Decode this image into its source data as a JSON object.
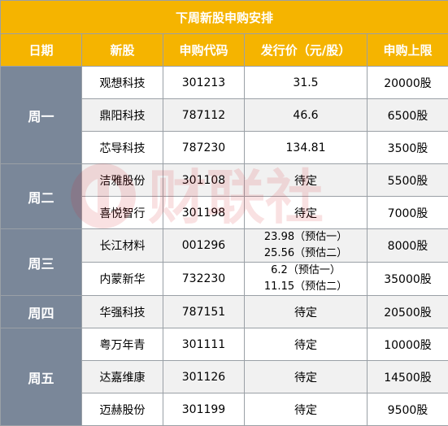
{
  "title": "下周新股申购安排",
  "headers": [
    "日期",
    "新股",
    "申购代码",
    "发行价（元/股）",
    "申购上限"
  ],
  "groups": [
    {
      "day": "周一",
      "rows": [
        {
          "name": "观想科技",
          "code": "301213",
          "price": "31.5",
          "limit": "20000股"
        },
        {
          "name": "鼎阳科技",
          "code": "787112",
          "price": "46.6",
          "limit": "6500股"
        },
        {
          "name": "芯导科技",
          "code": "787230",
          "price": "134.81",
          "limit": "3500股"
        }
      ]
    },
    {
      "day": "周二",
      "rows": [
        {
          "name": "洁雅股份",
          "code": "301108",
          "price": "待定",
          "limit": "5500股"
        },
        {
          "name": "喜悦智行",
          "code": "301198",
          "price": "待定",
          "limit": "7000股"
        }
      ]
    },
    {
      "day": "周三",
      "rows": [
        {
          "name": "长江材料",
          "code": "001296",
          "price_lines": [
            "23.98（预估一）",
            "25.56（预估二）"
          ],
          "limit": "8000股"
        },
        {
          "name": "内蒙新华",
          "code": "732230",
          "price_lines": [
            "6.2（预估一）",
            "11.15（预估二）"
          ],
          "limit": "35000股"
        }
      ]
    },
    {
      "day": "周四",
      "rows": [
        {
          "name": "华强科技",
          "code": "787151",
          "price": "待定",
          "limit": "20500股"
        }
      ]
    },
    {
      "day": "周五",
      "rows": [
        {
          "name": "粤万年青",
          "code": "301111",
          "price": "待定",
          "limit": "10000股"
        },
        {
          "name": "达嘉维康",
          "code": "301126",
          "price": "待定",
          "limit": "14500股"
        },
        {
          "name": "迈赫股份",
          "code": "301199",
          "price": "待定",
          "limit": "9500股"
        }
      ]
    }
  ],
  "watermark": {
    "icon": "cailian-logo-icon",
    "text": "财联社"
  },
  "colors": {
    "header": "#f5b400",
    "day_cell": "#7a8799",
    "border": "#9aa0a6"
  }
}
